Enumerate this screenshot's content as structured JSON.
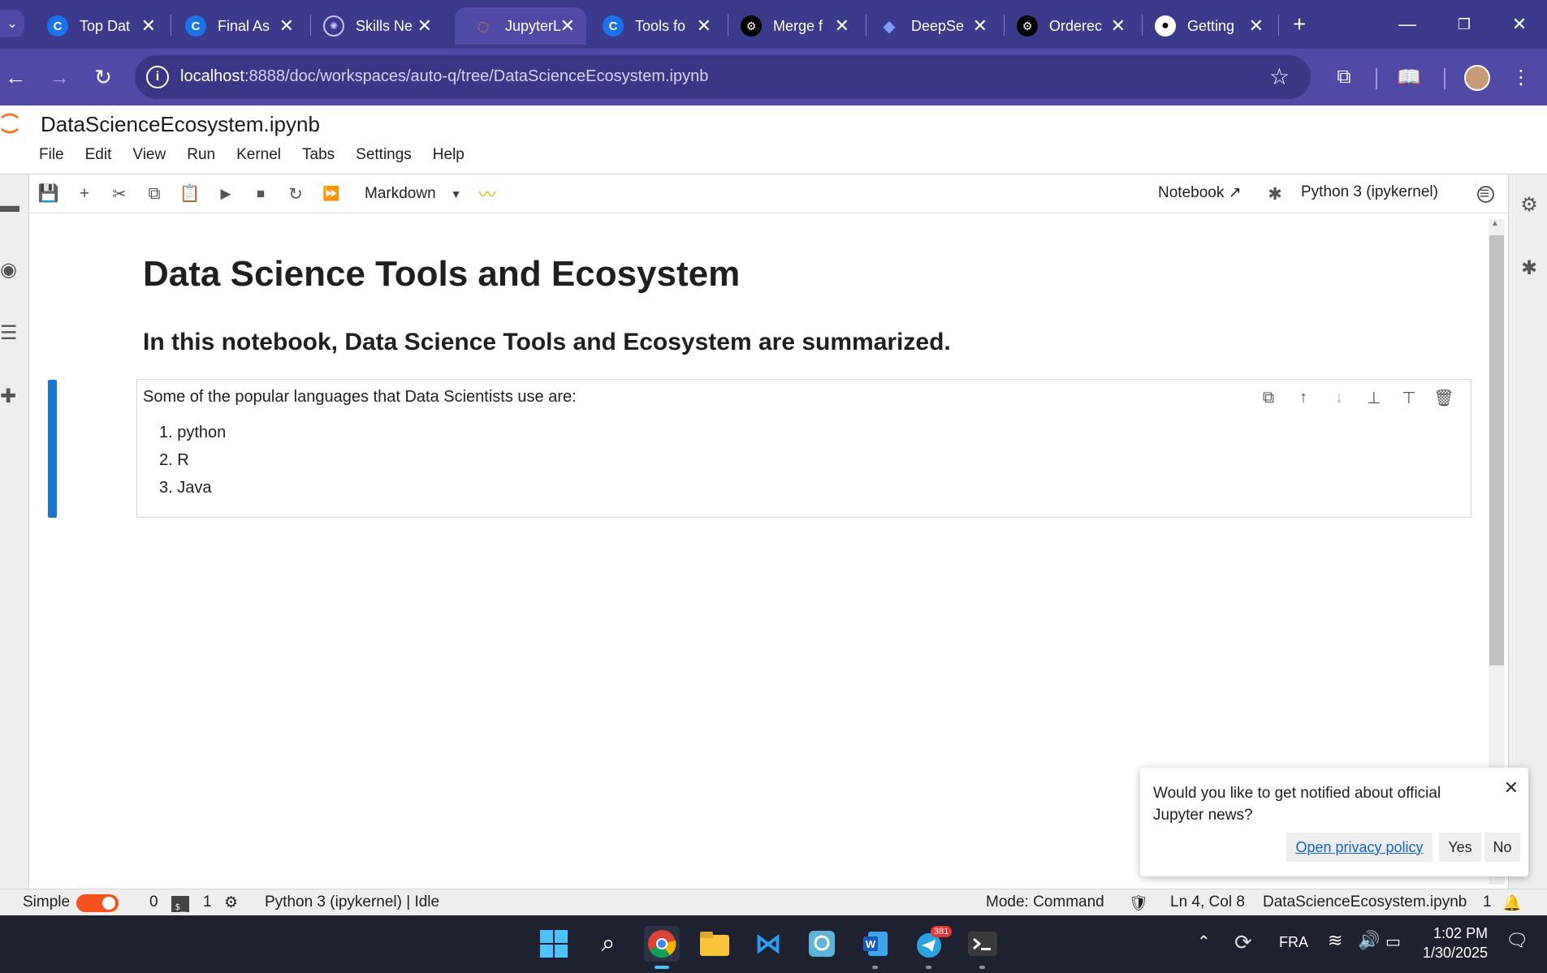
{
  "browser": {
    "tabs": [
      {
        "label": "Top Dat",
        "icon": "C",
        "color": "#1a73e8"
      },
      {
        "label": "Final As",
        "icon": "C",
        "color": "#1a73e8"
      },
      {
        "label": "Skills Ne",
        "icon": "skills-network-icon",
        "color": "#7b61ff"
      },
      {
        "label": "JupyterL",
        "icon": "jupyter-icon",
        "color": "#f37626"
      },
      {
        "label": "Tools fo",
        "icon": "C",
        "color": "#1a73e8"
      },
      {
        "label": "Merge f",
        "icon": "openai-icon",
        "color": "#000000"
      },
      {
        "label": "DeepSe",
        "icon": "deepseek-icon",
        "color": "#4d6bfe"
      },
      {
        "label": "Orderec",
        "icon": "openai-icon",
        "color": "#000000"
      },
      {
        "label": "Getting",
        "icon": "github-icon",
        "color": "#000000"
      }
    ],
    "active_tab_index": 3,
    "url_host": "localhost",
    "url_path": ":8888/doc/workspaces/auto-q/tree/DataScienceEcosystem.ipynb",
    "new_tab_symbol": "+"
  },
  "jupyter": {
    "notebook_title": "DataScienceEcosystem.ipynb",
    "menu": [
      "File",
      "Edit",
      "View",
      "Run",
      "Kernel",
      "Tabs",
      "Settings",
      "Help"
    ],
    "cell_type": "Markdown",
    "notebook_link": "Notebook",
    "kernel": "Python 3 (ipykernel)"
  },
  "notebook": {
    "heading1": "Data Science Tools and Ecosystem",
    "heading2": "In this notebook, Data Science Tools and Ecosystem are summarized.",
    "cell_intro": "Some of the popular languages that Data Scientists use are:",
    "languages": [
      "1. python",
      "2. R",
      "3. Java"
    ]
  },
  "notification": {
    "message": "Would you like to get notified about official Jupyter news?",
    "privacy_label": "Open privacy policy",
    "yes_label": "Yes",
    "no_label": "No"
  },
  "statusbar": {
    "mode_label": "Simple",
    "terminals_count": "0",
    "kernels_count": "1",
    "kernel_status": "Python 3 (ipykernel) | Idle",
    "mode": "Mode: Command",
    "cursor": "Ln 4, Col 8",
    "filename": "DataScienceEcosystem.ipynb",
    "notification_count": "1"
  },
  "taskbar": {
    "telegram_badge": "381",
    "language": "FRA",
    "time": "1:02 PM",
    "date": "1/30/2025"
  },
  "colors": {
    "browser_frame": "#3c3a8c",
    "browser_toolbar": "#504aa6",
    "cell_active_bar": "#1976d2",
    "toggle_on": "#f4511e",
    "taskbar": "#1e2230"
  }
}
